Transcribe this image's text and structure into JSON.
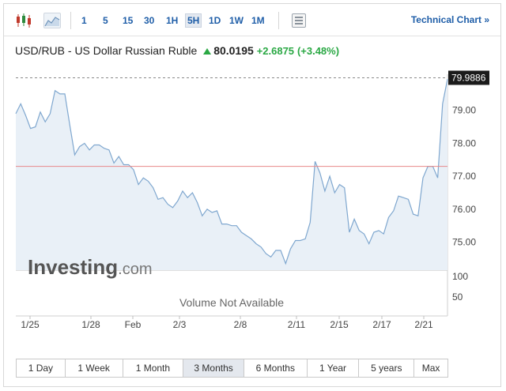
{
  "toolbar": {
    "timeframes": [
      "1",
      "5",
      "15",
      "30",
      "1H",
      "5H",
      "1D",
      "1W",
      "1M"
    ],
    "active_timeframe": "5H",
    "technical_chart_label": "Technical Chart »"
  },
  "quote": {
    "name": "USD/RUB - US Dollar Russian Ruble",
    "price": "80.0195",
    "change": "+2.6875",
    "change_pct": "(+3.48%)",
    "up_color": "#2aa844"
  },
  "chart_data": {
    "type": "area",
    "x_tick_labels": [
      "1/25",
      "1/28",
      "Feb",
      "2/3",
      "2/8",
      "2/11",
      "2/15",
      "2/17",
      "2/21"
    ],
    "y_tick_labels": [
      "79.00",
      "78.00",
      "77.00",
      "76.00",
      "75.00"
    ],
    "ylim": [
      74.15,
      80.0
    ],
    "last_value_label": "79.9886",
    "reference_line": 77.3,
    "volume_tick_labels": [
      "100",
      "50"
    ],
    "volume_message": "Volume Not Available",
    "watermark": {
      "brand": "Investing",
      "suffix": ".com"
    },
    "series": [
      {
        "values": [
          78.9,
          79.2,
          78.85,
          78.45,
          78.5,
          78.95,
          78.65,
          78.9,
          79.6,
          79.5,
          79.5,
          78.55,
          77.65,
          77.9,
          78.0,
          77.8,
          77.95,
          77.95,
          77.85,
          77.8,
          77.4,
          77.6,
          77.35,
          77.35,
          77.2,
          76.75,
          76.95,
          76.85,
          76.65,
          76.3,
          76.35,
          76.15,
          76.05,
          76.25,
          76.55,
          76.35,
          76.5,
          76.2,
          75.8,
          76.0,
          75.9,
          75.95,
          75.55,
          75.55,
          75.5,
          75.5,
          75.3,
          75.2,
          75.1,
          74.95,
          74.85,
          74.65,
          74.55,
          74.75,
          74.75,
          74.35,
          74.8,
          75.05,
          75.05,
          75.1,
          75.6,
          77.45,
          77.1,
          76.55,
          77.0,
          76.5,
          76.75,
          76.65,
          75.3,
          75.7,
          75.35,
          75.25,
          74.95,
          75.3,
          75.35,
          75.25,
          75.75,
          75.95,
          76.4,
          76.35,
          76.3,
          75.85,
          75.8,
          76.95,
          77.3,
          77.3,
          76.95,
          79.2,
          79.95
        ]
      }
    ],
    "colors": {
      "line": "#7fa7cf",
      "fill": "#e9f0f7",
      "reference": "#e88a8a",
      "grid": "#e6e6e6"
    }
  },
  "ranges": {
    "items": [
      "1 Day",
      "1 Week",
      "1 Month",
      "3 Months",
      "6 Months",
      "1 Year",
      "5 years",
      "Max"
    ],
    "active": "3 Months"
  }
}
